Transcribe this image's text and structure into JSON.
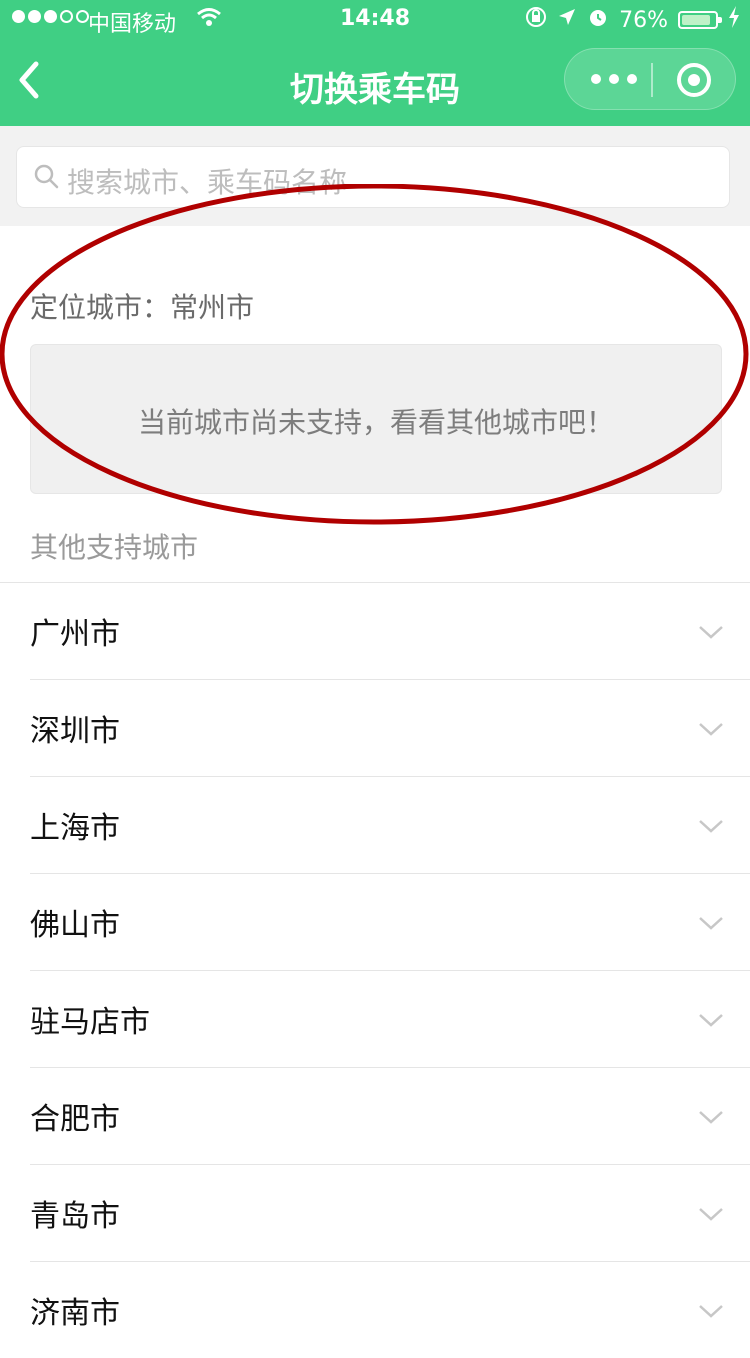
{
  "status_bar": {
    "carrier": "中国移动",
    "time": "14:48",
    "battery": "76%",
    "icons": [
      "signal-dots",
      "wifi-icon",
      "lock-rotation-icon",
      "location-arrow-icon",
      "alarm-icon",
      "battery-icon",
      "charging-bolt-icon"
    ]
  },
  "header": {
    "back_icon": "chevron-left-icon",
    "title": "切换乘车码",
    "capsule": {
      "more_icon": "more-dots-icon",
      "close_icon": "target-close-icon"
    }
  },
  "search": {
    "placeholder": "搜索城市、乘车码名称",
    "icon": "search-icon"
  },
  "location": {
    "label": "定位城市：常州市",
    "notice": "当前城市尚未支持，看看其他城市吧！"
  },
  "other_section": {
    "label": "其他支持城市",
    "cities": [
      "广州市",
      "深圳市",
      "上海市",
      "佛山市",
      "驻马店市",
      "合肥市",
      "青岛市",
      "济南市"
    ]
  },
  "colors": {
    "brand_green": "#40cf84",
    "annotation_red": "#b00000"
  }
}
